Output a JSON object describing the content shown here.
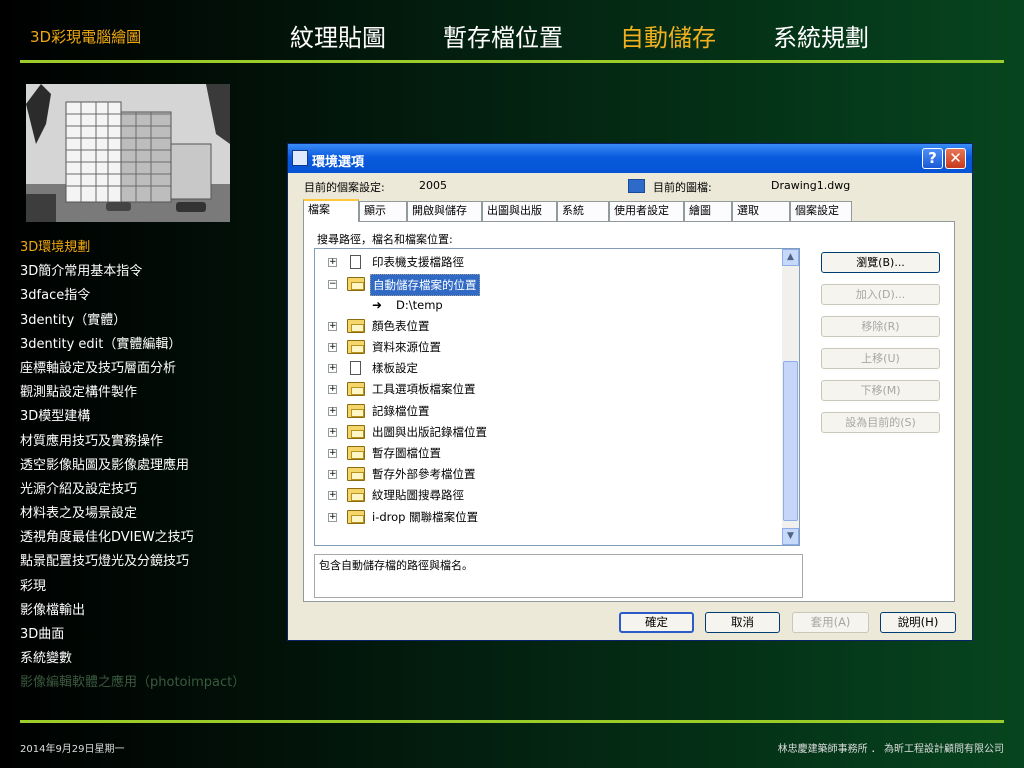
{
  "header": {
    "brand": "3D彩現電腦繪圖",
    "nav": [
      "紋理貼圖",
      "暫存檔位置",
      "自動儲存",
      "系統規劃"
    ],
    "active_nav": "自動儲存",
    "accent_color": "#f0a810",
    "rule_color": "#9ccc2a"
  },
  "sidebar": {
    "items": [
      "3D環境規劃",
      "3D簡介常用基本指令",
      "3dface指令",
      "3dentity（實體）",
      "3dentity edit（實體編輯）",
      "座標軸設定及技巧層面分析",
      "觀測點設定構件製作",
      "3D模型建構",
      "材質應用技巧及實務操作",
      "透空影像貼圖及影像處理應用",
      "光源介紹及設定技巧",
      "材料表之及場景設定",
      "透視角度最佳化DVIEW之技巧",
      "點景配置技巧燈光及分鏡技巧",
      "彩現",
      "影像檔輸出",
      "3D曲面",
      "系統變數",
      "影像編輯軟體之應用（photoimpact）"
    ]
  },
  "dialog": {
    "title": "環境選項",
    "help_glyph": "?",
    "close_glyph": "✕",
    "profile_label": "目前的個案設定:",
    "profile_value": "2005",
    "drawing_label": "目前的圖檔:",
    "drawing_value": "Drawing1.dwg",
    "tabs": [
      "檔案",
      "顯示",
      "開啟與儲存",
      "出圖與出版",
      "系統",
      "使用者設定",
      "繪圖",
      "選取",
      "個案設定"
    ],
    "tree_heading": "搜尋路徑，檔名和檔案位置:",
    "tree": [
      {
        "expander": "+",
        "icon": "doc",
        "label": "印表機支援檔路徑"
      },
      {
        "expander": "−",
        "icon": "folder",
        "label": "自動儲存檔案的位置",
        "selected": true
      },
      {
        "expander": "",
        "icon": "arrow",
        "label": "D:\\temp",
        "child": true
      },
      {
        "expander": "+",
        "icon": "folder",
        "label": "顏色表位置"
      },
      {
        "expander": "+",
        "icon": "folder",
        "label": "資料來源位置"
      },
      {
        "expander": "+",
        "icon": "doc",
        "label": "樣板設定"
      },
      {
        "expander": "+",
        "icon": "folder",
        "label": "工具選項板檔案位置"
      },
      {
        "expander": "+",
        "icon": "folder",
        "label": "記錄檔位置"
      },
      {
        "expander": "+",
        "icon": "folder",
        "label": "出圖與出版記錄檔位置"
      },
      {
        "expander": "+",
        "icon": "folder",
        "label": "暫存圖檔位置"
      },
      {
        "expander": "+",
        "icon": "folder",
        "label": "暫存外部參考檔位置"
      },
      {
        "expander": "+",
        "icon": "folder",
        "label": "紋理貼圖搜尋路徑"
      },
      {
        "expander": "+",
        "icon": "folder",
        "label": "i-drop 關聯檔案位置"
      }
    ],
    "side_buttons": [
      {
        "label": "瀏覽(B)...",
        "enabled": true
      },
      {
        "label": "加入(D)...",
        "enabled": false
      },
      {
        "label": "移除(R)",
        "enabled": false
      },
      {
        "label": "上移(U)",
        "enabled": false
      },
      {
        "label": "下移(M)",
        "enabled": false
      },
      {
        "label": "設為目前的(S)",
        "enabled": false
      }
    ],
    "description": "包含自動儲存檔的路徑與檔名。",
    "bottom_buttons": [
      {
        "label": "確定",
        "enabled": true,
        "default": true
      },
      {
        "label": "取消",
        "enabled": true
      },
      {
        "label": "套用(A)",
        "enabled": false
      },
      {
        "label": "說明(H)",
        "enabled": true
      }
    ]
  },
  "footer": {
    "date": "2014年9月29日星期一",
    "org": "林忠慶建築師事務所 ． 為昕工程設計顧問有限公司"
  }
}
